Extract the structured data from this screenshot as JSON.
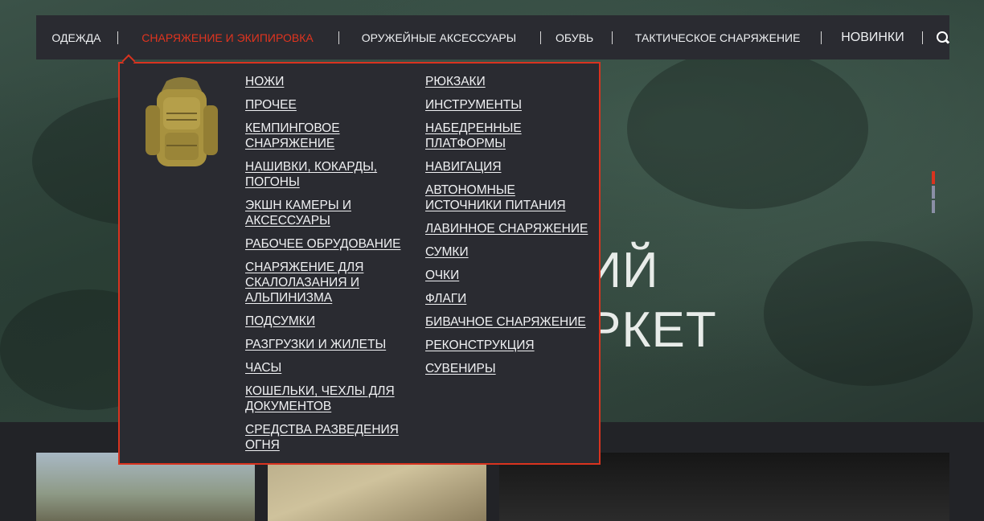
{
  "nav": {
    "items": [
      {
        "label": "ОДЕЖДА"
      },
      {
        "label": "СНАРЯЖЕНИЕ И ЭКИПИРОВКА"
      },
      {
        "label": "ОРУЖЕЙНЫЕ АКСЕССУАРЫ"
      },
      {
        "label": "ОБУВЬ"
      },
      {
        "label": "ТАКТИЧЕСКОЕ СНАРЯЖЕНИЕ"
      },
      {
        "label": "НОВИНКИ"
      }
    ],
    "active_index": 1,
    "search_icon": "search-icon"
  },
  "dropdown": {
    "image_icon": "backpack-image",
    "column1": [
      "НОЖИ",
      "ПРОЧЕЕ",
      "КЕМПИНГОВОЕ СНАРЯЖЕНИЕ",
      "НАШИВКИ, КОКАРДЫ, ПОГОНЫ",
      "ЭКШН КАМЕРЫ И АКСЕССУАРЫ",
      "РАБОЧЕЕ ОБРУДОВАНИЕ",
      "СНАРЯЖЕНИЕ ДЛЯ СКАЛОЛАЗАНИЯ И АЛЬПИНИЗМА",
      "ПОДСУМКИ",
      "РАЗГРУЗКИ И ЖИЛЕТЫ",
      "ЧАСЫ",
      "КОШЕЛЬКИ, ЧЕХЛЫ ДЛЯ ДОКУМЕНТОВ",
      "СРЕДСТВА РАЗВЕДЕНИЯ ОГНЯ"
    ],
    "column2": [
      "РЮКЗАКИ",
      "ИНСТРУМЕНТЫ",
      "НАБЕДРЕННЫЕ ПЛАТФОРМЫ",
      "НАВИГАЦИЯ",
      "АВТОНОМНЫЕ ИСТОЧНИКИ ПИТАНИЯ",
      "ЛАВИННОЕ СНАРЯЖЕНИЕ",
      "СУМКИ",
      "ОЧКИ",
      "ФЛАГИ",
      "БИВАЧНОЕ СНАРЯЖЕНИЕ",
      "РЕКОНСТРУКЦИЯ",
      "СУВЕНИРЫ"
    ]
  },
  "hero": {
    "line1": "ЙСКИЙ",
    "line2": "МАРКЕТ"
  },
  "slider": {
    "count": 3,
    "active_index": 0
  },
  "colors": {
    "accent": "#d9331f",
    "nav_bg": "#2a2b31",
    "page_bg": "#222327"
  }
}
